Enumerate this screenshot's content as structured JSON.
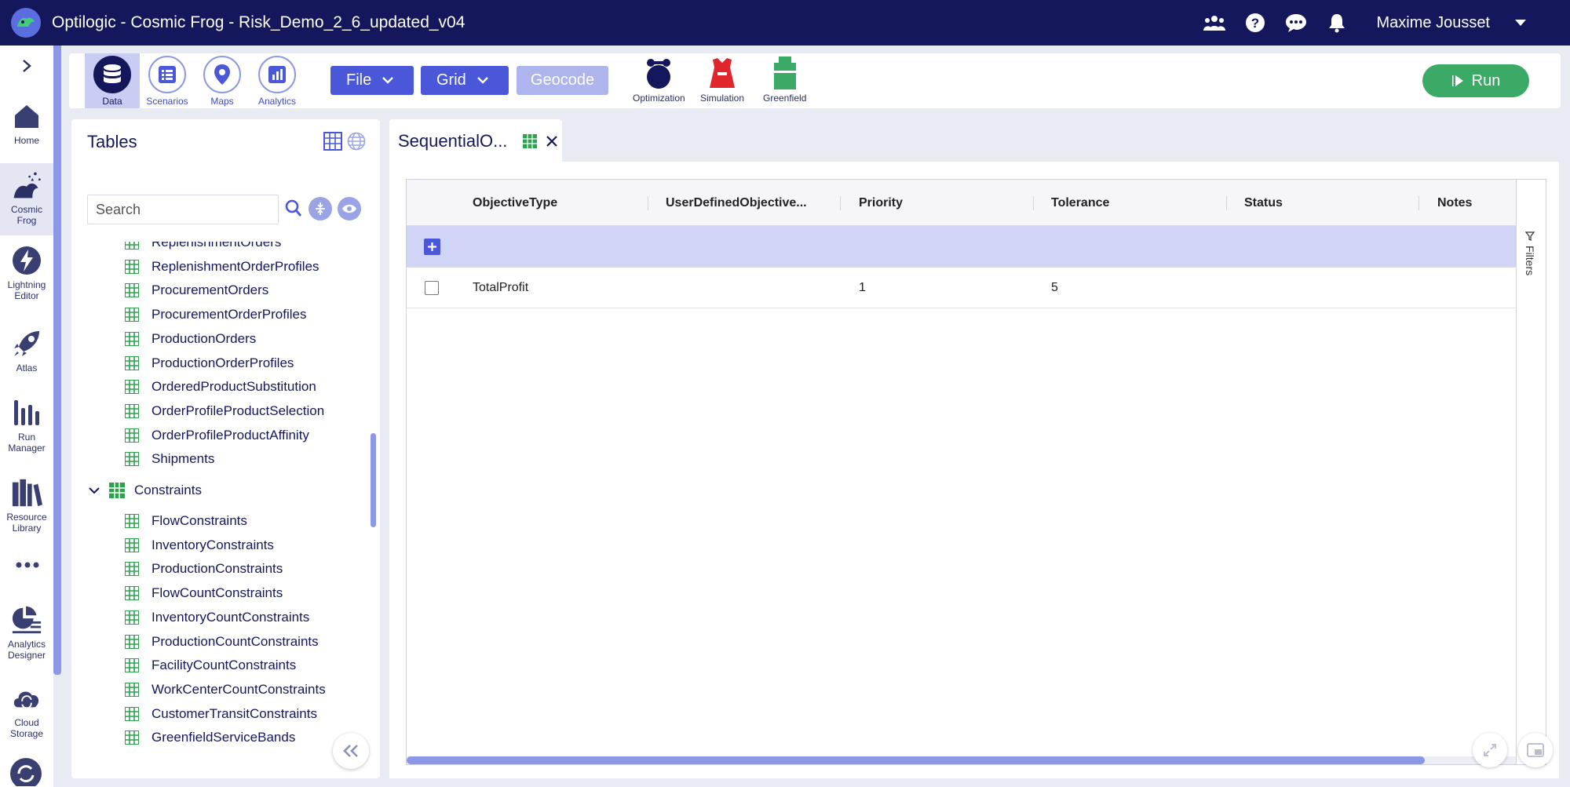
{
  "app": {
    "title": "Optilogic - Cosmic Frog - Risk_Demo_2_6_updated_v04"
  },
  "topbar": {
    "user_name": "Maxime Jousset"
  },
  "rail": {
    "items": [
      {
        "label_1": "Home",
        "label_2": ""
      },
      {
        "label_1": "Cosmic",
        "label_2": "Frog"
      },
      {
        "label_1": "Lightning",
        "label_2": "Editor"
      },
      {
        "label_1": "Atlas",
        "label_2": ""
      },
      {
        "label_1": "Run",
        "label_2": "Manager"
      },
      {
        "label_1": "Resource",
        "label_2": "Library"
      },
      {
        "label_1": "Analytics",
        "label_2": "Designer"
      },
      {
        "label_1": "Cloud",
        "label_2": "Storage"
      }
    ]
  },
  "toolbar": {
    "tabs": [
      {
        "label": "Data"
      },
      {
        "label": "Scenarios"
      },
      {
        "label": "Maps"
      },
      {
        "label": "Analytics"
      }
    ],
    "file_label": "File",
    "grid_label": "Grid",
    "geocode_label": "Geocode",
    "engines": [
      {
        "label": "Optimization"
      },
      {
        "label": "Simulation"
      },
      {
        "label": "Greenfield"
      }
    ],
    "run_label": "Run"
  },
  "tables_panel": {
    "title": "Tables",
    "search_placeholder": "Search",
    "items_top": [
      "ReplenishmentOrders",
      "ReplenishmentOrderProfiles",
      "ProcurementOrders",
      "ProcurementOrderProfiles",
      "ProductionOrders",
      "ProductionOrderProfiles",
      "OrderedProductSubstitution",
      "OrderProfileProductSelection",
      "OrderProfileProductAffinity",
      "Shipments"
    ],
    "group": "Constraints",
    "items_group": [
      "FlowConstraints",
      "InventoryConstraints",
      "ProductionConstraints",
      "FlowCountConstraints",
      "InventoryCountConstraints",
      "ProductionCountConstraints",
      "FacilityCountConstraints",
      "WorkCenterCountConstraints",
      "CustomerTransitConstraints",
      "GreenfieldServiceBands"
    ]
  },
  "doc_tab": {
    "label": "SequentialO..."
  },
  "grid": {
    "columns": [
      "ObjectiveType",
      "UserDefinedObjective...",
      "Priority",
      "Tolerance",
      "Status",
      "Notes"
    ],
    "rows": [
      {
        "ObjectiveType": "TotalProfit",
        "UserDefinedObjective": "",
        "Priority": "1",
        "Tolerance": "5",
        "Status": "",
        "Notes": ""
      }
    ],
    "filters_label": "Filters"
  },
  "colors": {
    "topbar_bg": "#14175c",
    "accent": "#4a57d8",
    "run_green": "#3aaa66",
    "table_icon_green": "#2ea24f"
  }
}
